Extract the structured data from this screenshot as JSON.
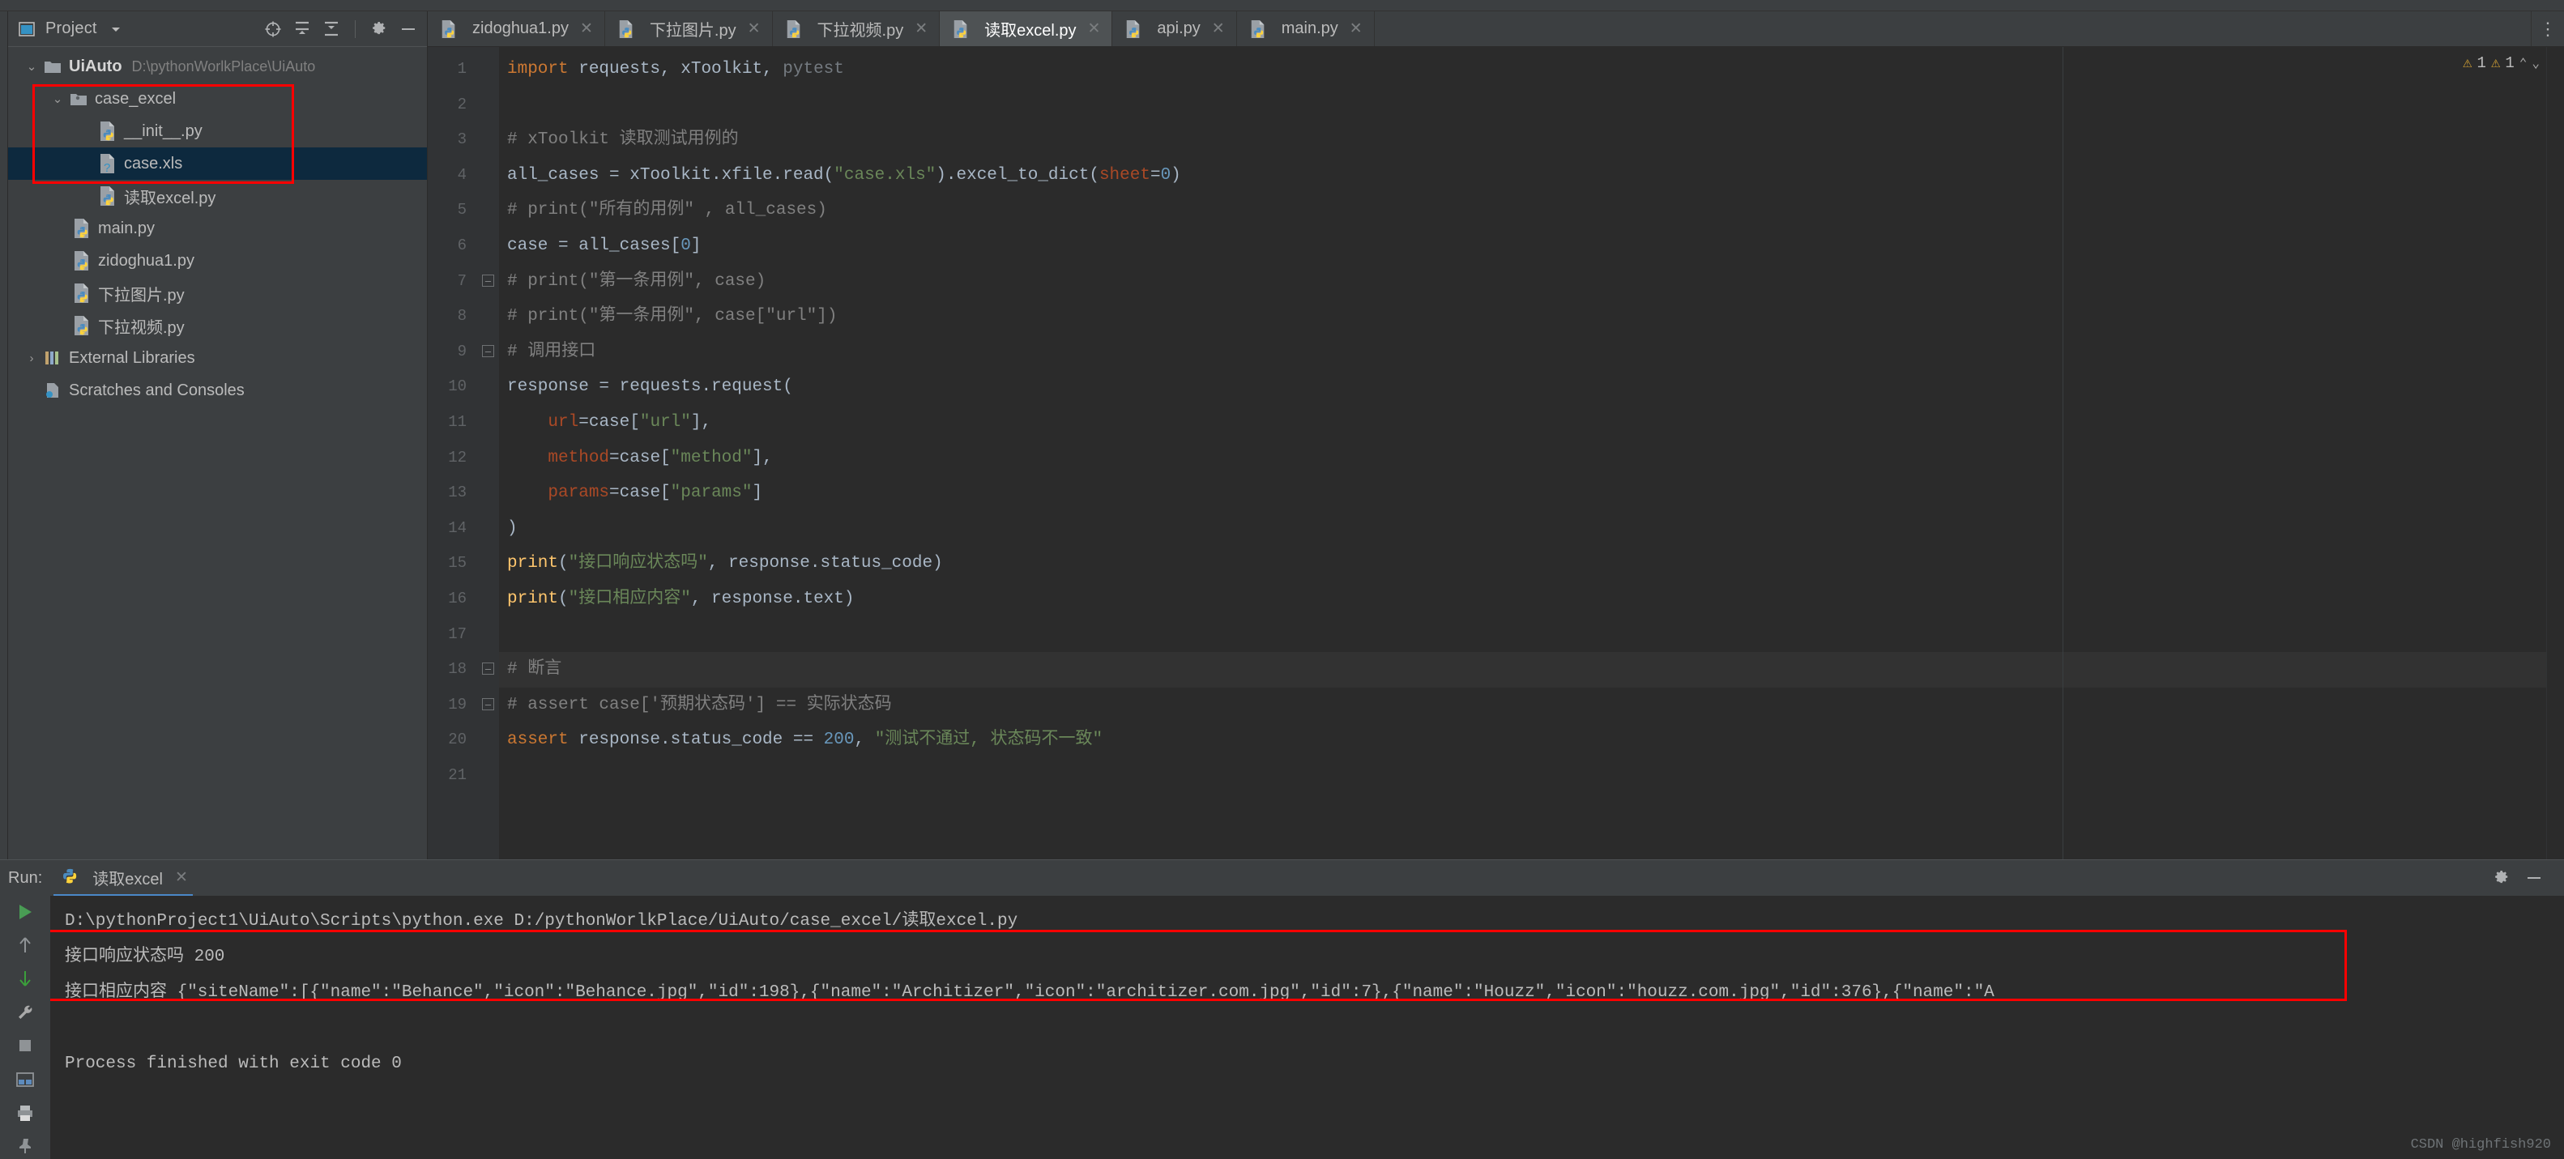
{
  "app": {
    "theme_bg": "#3c3f41",
    "editor_bg": "#2b2b2b",
    "accent": "#4a88c7",
    "annotation_color": "#ff0000"
  },
  "project_panel": {
    "title": "Project",
    "icons": [
      "project-window-icon",
      "chevron-down-icon",
      "locate-icon",
      "expand-all-icon",
      "collapse-all-icon",
      "gear-icon",
      "minimize-icon"
    ],
    "tree": [
      {
        "label": "UiAuto",
        "path": "D:\\pythonWorlkPlace\\UiAuto",
        "icon": "folder-icon",
        "twisty": "⌄",
        "depth": 0,
        "bold": true,
        "selected": false
      },
      {
        "label": "case_excel",
        "path": "",
        "icon": "source-folder-icon",
        "twisty": "⌄",
        "depth": 1,
        "bold": false,
        "selected": false
      },
      {
        "label": "__init__.py",
        "path": "",
        "icon": "python-file-icon",
        "twisty": "",
        "depth": 2,
        "bold": false,
        "selected": false
      },
      {
        "label": "case.xls",
        "path": "",
        "icon": "unknown-file-icon",
        "twisty": "",
        "depth": 2,
        "bold": false,
        "selected": true
      },
      {
        "label": "读取excel.py",
        "path": "",
        "icon": "python-file-icon",
        "twisty": "",
        "depth": 2,
        "bold": false,
        "selected": false
      },
      {
        "label": "main.py",
        "path": "",
        "icon": "python-file-icon",
        "twisty": "",
        "depth": 1,
        "bold": false,
        "selected": false
      },
      {
        "label": "zidoghua1.py",
        "path": "",
        "icon": "python-file-icon",
        "twisty": "",
        "depth": 1,
        "bold": false,
        "selected": false
      },
      {
        "label": "下拉图片.py",
        "path": "",
        "icon": "python-file-icon",
        "twisty": "",
        "depth": 1,
        "bold": false,
        "selected": false
      },
      {
        "label": "下拉视频.py",
        "path": "",
        "icon": "python-file-icon",
        "twisty": "",
        "depth": 1,
        "bold": false,
        "selected": false
      },
      {
        "label": "External Libraries",
        "path": "",
        "icon": "library-icon",
        "twisty": "›",
        "depth": 0,
        "bold": false,
        "selected": false
      },
      {
        "label": "Scratches and Consoles",
        "path": "",
        "icon": "scratches-icon",
        "twisty": "",
        "depth": 0,
        "bold": false,
        "selected": false
      }
    ]
  },
  "editor": {
    "tabs": [
      {
        "label": "zidoghua1.py",
        "icon": "python-file-icon",
        "active": false,
        "close": "✕"
      },
      {
        "label": "下拉图片.py",
        "icon": "python-file-icon",
        "active": false,
        "close": "✕"
      },
      {
        "label": "下拉视频.py",
        "icon": "python-file-icon",
        "active": false,
        "close": "✕"
      },
      {
        "label": "读取excel.py",
        "icon": "python-file-icon",
        "active": true,
        "close": "✕"
      },
      {
        "label": "api.py",
        "icon": "python-file-icon",
        "active": false,
        "close": "✕"
      },
      {
        "label": "main.py",
        "icon": "python-file-icon",
        "active": false,
        "close": "✕"
      }
    ],
    "tab_overflow_icon": "more-vertical-icon",
    "inspection": {
      "warning_icon": "warning-triangle-icon",
      "warning_count": "1",
      "weak_warning_icon": "warning-triangle-icon",
      "weak_warning_count": "1",
      "up_chevron": "⌃",
      "down_chevron": "⌄"
    },
    "line_numbers": [
      "1",
      "2",
      "3",
      "4",
      "5",
      "6",
      "7",
      "8",
      "9",
      "10",
      "11",
      "12",
      "13",
      "14",
      "15",
      "16",
      "17",
      "18",
      "19",
      "20",
      "21"
    ],
    "highlighted_line": 18,
    "lines": [
      {
        "n": 1,
        "fold": "",
        "tokens": [
          {
            "t": "import ",
            "c": "kw"
          },
          {
            "t": "requests, xToolkit, ",
            "c": "ident"
          },
          {
            "t": "pytest",
            "c": "dim"
          }
        ]
      },
      {
        "n": 2,
        "fold": "",
        "tokens": []
      },
      {
        "n": 3,
        "fold": "",
        "tokens": [
          {
            "t": "# xToolkit 读取测试用例的",
            "c": "cmt"
          }
        ]
      },
      {
        "n": 4,
        "fold": "",
        "tokens": [
          {
            "t": "all_cases = xToolkit.xfile.read(",
            "c": "ident"
          },
          {
            "t": "\"case.xls\"",
            "c": "str"
          },
          {
            "t": ").excel_to_dict(",
            "c": "ident"
          },
          {
            "t": "sheet",
            "c": "param"
          },
          {
            "t": "=",
            "c": "ident"
          },
          {
            "t": "0",
            "c": "num"
          },
          {
            "t": ")",
            "c": "ident"
          }
        ]
      },
      {
        "n": 5,
        "fold": "",
        "tokens": [
          {
            "t": "# print(\"所有的用例\" , all_cases)",
            "c": "cmt"
          }
        ]
      },
      {
        "n": 6,
        "fold": "",
        "tokens": [
          {
            "t": "case = all_cases[",
            "c": "ident"
          },
          {
            "t": "0",
            "c": "num"
          },
          {
            "t": "]",
            "c": "ident"
          }
        ]
      },
      {
        "n": 7,
        "fold": "fold-start",
        "tokens": [
          {
            "t": "# print(\"第一条用例\", case)",
            "c": "cmt"
          }
        ]
      },
      {
        "n": 8,
        "fold": "",
        "tokens": [
          {
            "t": "# print(\"第一条用例\", case[\"url\"])",
            "c": "cmt"
          }
        ]
      },
      {
        "n": 9,
        "fold": "fold-start",
        "tokens": [
          {
            "t": "# 调用接口",
            "c": "cmt"
          }
        ]
      },
      {
        "n": 10,
        "fold": "",
        "tokens": [
          {
            "t": "response = requests.request(",
            "c": "ident"
          }
        ]
      },
      {
        "n": 11,
        "fold": "",
        "tokens": [
          {
            "t": "    ",
            "c": "ident"
          },
          {
            "t": "url",
            "c": "param"
          },
          {
            "t": "=case[",
            "c": "ident"
          },
          {
            "t": "\"url\"",
            "c": "str"
          },
          {
            "t": "],",
            "c": "ident"
          }
        ]
      },
      {
        "n": 12,
        "fold": "",
        "tokens": [
          {
            "t": "    ",
            "c": "ident"
          },
          {
            "t": "method",
            "c": "param"
          },
          {
            "t": "=case[",
            "c": "ident"
          },
          {
            "t": "\"method\"",
            "c": "str"
          },
          {
            "t": "],",
            "c": "ident"
          }
        ]
      },
      {
        "n": 13,
        "fold": "",
        "tokens": [
          {
            "t": "    ",
            "c": "ident"
          },
          {
            "t": "params",
            "c": "param"
          },
          {
            "t": "=case[",
            "c": "ident"
          },
          {
            "t": "\"params\"",
            "c": "str"
          },
          {
            "t": "]",
            "c": "ident"
          }
        ]
      },
      {
        "n": 14,
        "fold": "",
        "tokens": [
          {
            "t": ")",
            "c": "ident"
          }
        ]
      },
      {
        "n": 15,
        "fold": "",
        "tokens": [
          {
            "t": "print",
            "c": "fn"
          },
          {
            "t": "(",
            "c": "ident"
          },
          {
            "t": "\"接口响应状态吗\"",
            "c": "str"
          },
          {
            "t": ", response.status_code)",
            "c": "ident"
          }
        ]
      },
      {
        "n": 16,
        "fold": "",
        "tokens": [
          {
            "t": "print",
            "c": "fn"
          },
          {
            "t": "(",
            "c": "ident"
          },
          {
            "t": "\"接口相应内容\"",
            "c": "str"
          },
          {
            "t": ", response.text)",
            "c": "ident"
          }
        ]
      },
      {
        "n": 17,
        "fold": "",
        "tokens": []
      },
      {
        "n": 18,
        "fold": "fold-start",
        "tokens": [
          {
            "t": "# 断言",
            "c": "cmt"
          }
        ]
      },
      {
        "n": 19,
        "fold": "fold-start",
        "tokens": [
          {
            "t": "# assert case['预期状态码'] == 实际状态码",
            "c": "cmt"
          }
        ]
      },
      {
        "n": 20,
        "fold": "",
        "tokens": [
          {
            "t": "assert ",
            "c": "kw"
          },
          {
            "t": "response.status_code == ",
            "c": "ident"
          },
          {
            "t": "200",
            "c": "num"
          },
          {
            "t": ", ",
            "c": "ident"
          },
          {
            "t": "\"测试不通过, 状态码不一致\"",
            "c": "str"
          }
        ]
      },
      {
        "n": 21,
        "fold": "",
        "tokens": []
      }
    ]
  },
  "run_panel": {
    "label": "Run:",
    "tab_label": "读取excel",
    "tab_icon": "python-file-icon",
    "tab_close": "✕",
    "settings_icon": "gear-icon",
    "minimize_icon": "minimize-icon",
    "side_buttons": [
      "run-icon",
      "arrow-up-icon",
      "arrow-down-icon",
      "wrench-icon",
      "stop-icon",
      "layout-icon",
      "print-icon",
      "pin-icon"
    ],
    "console_lines": [
      "D:\\pythonProject1\\UiAuto\\Scripts\\python.exe D:/pythonWorlkPlace/UiAuto/case_excel/读取excel.py",
      "接口响应状态吗 200",
      "接口相应内容 {\"siteName\":[{\"name\":\"Behance\",\"icon\":\"Behance.jpg\",\"id\":198},{\"name\":\"Architizer\",\"icon\":\"architizer.com.jpg\",\"id\":7},{\"name\":\"Houzz\",\"icon\":\"houzz.com.jpg\",\"id\":376},{\"name\":\"A",
      "",
      "Process finished with exit code 0"
    ]
  },
  "watermark": "CSDN @highfish920"
}
